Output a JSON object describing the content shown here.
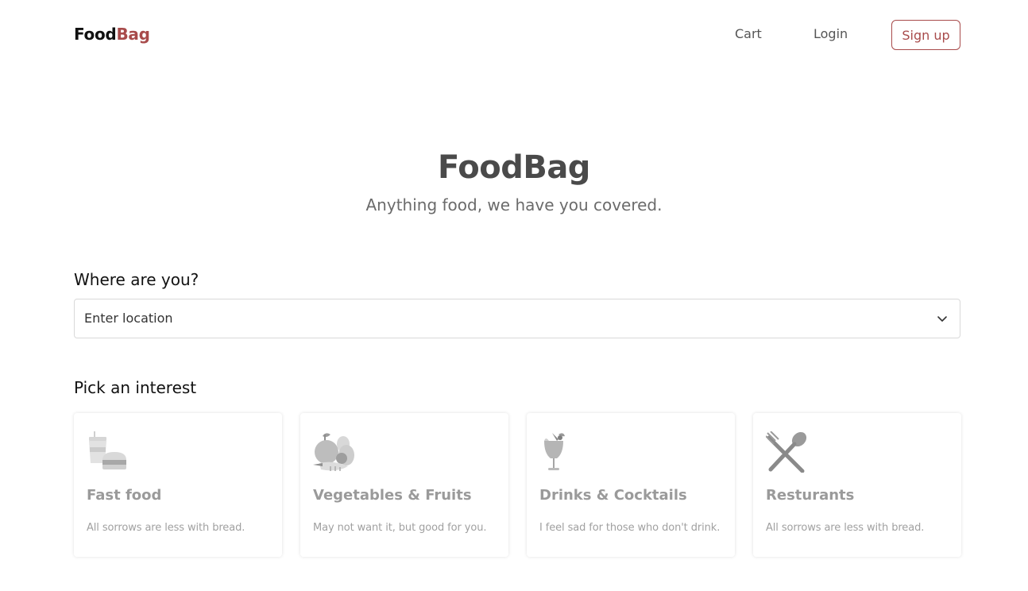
{
  "nav": {
    "logo_part1": "Food",
    "logo_part2": "Bag",
    "cart_label": "Cart",
    "login_label": "Login",
    "signup_label": "Sign up"
  },
  "hero": {
    "title": "FoodBag",
    "subtitle": "Anything food, we have you covered."
  },
  "location": {
    "label": "Where are you?",
    "placeholder": "Enter location"
  },
  "interests": {
    "heading": "Pick an interest",
    "items": [
      {
        "icon": "fast-food-icon",
        "title": "Fast food",
        "description": "All sorrows are less with bread."
      },
      {
        "icon": "vegetables-fruits-icon",
        "title": "Vegetables & Fruits",
        "description": "May not want it, but good for you."
      },
      {
        "icon": "cocktail-icon",
        "title": "Drinks & Cocktails",
        "description": "I feel sad for those who don't drink."
      },
      {
        "icon": "fork-spoon-icon",
        "title": "Resturants",
        "description": "All sorrows are less with bread."
      }
    ]
  },
  "colors": {
    "brand": "#a84b4b",
    "heading": "#4a4a4a",
    "muted": "#9a9a9a"
  }
}
